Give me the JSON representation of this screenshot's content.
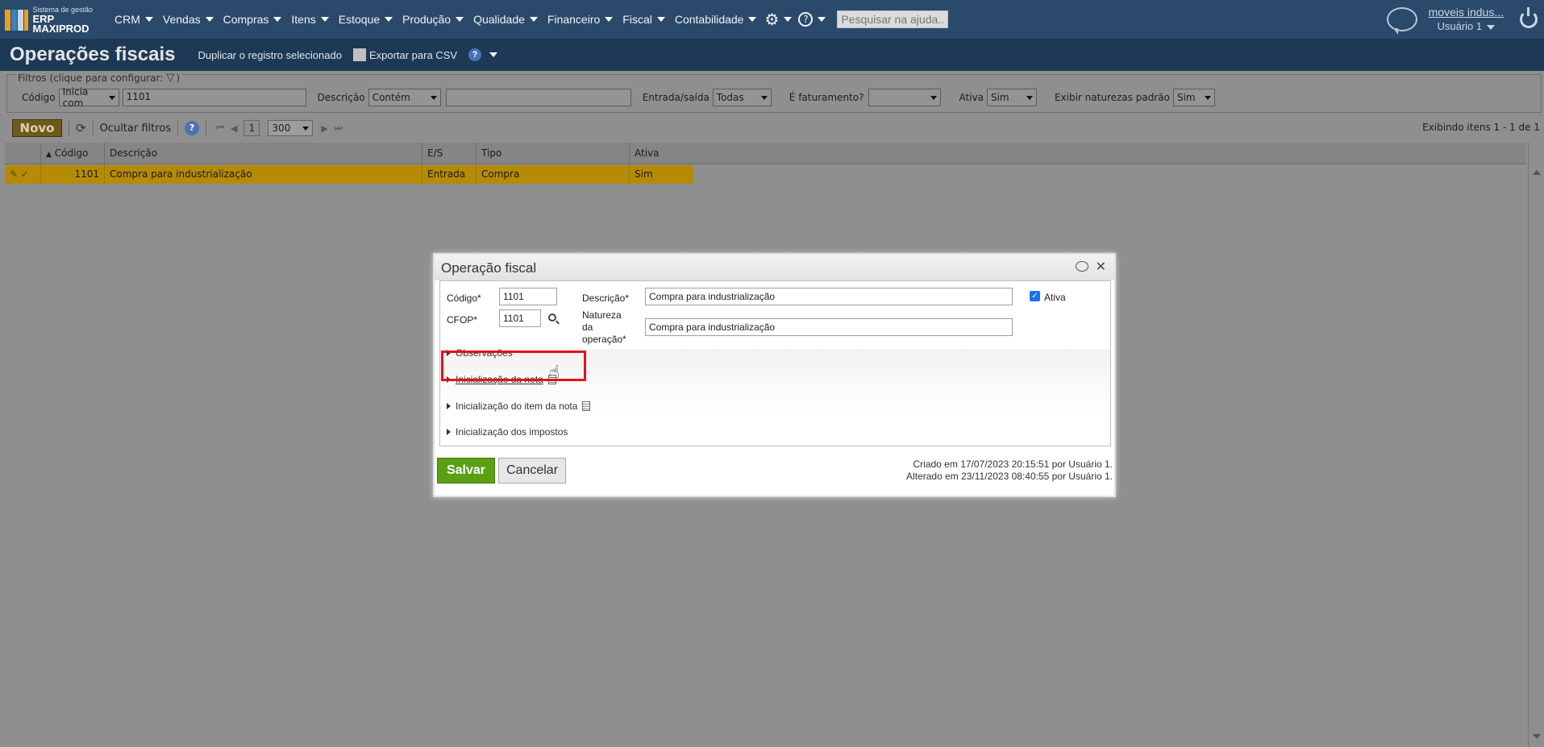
{
  "nav": {
    "logo_small": "Sistema de gestão",
    "logo_big": "ERP MAXIPROD",
    "menu": [
      {
        "label": "CRM"
      },
      {
        "label": "Vendas"
      },
      {
        "label": "Compras"
      },
      {
        "label": "Itens"
      },
      {
        "label": "Estoque"
      },
      {
        "label": "Produção"
      },
      {
        "label": "Qualidade"
      },
      {
        "label": "Financeiro"
      },
      {
        "label": "Fiscal"
      },
      {
        "label": "Contabilidade"
      }
    ],
    "help_placeholder": "Pesquisar na ajuda...",
    "company": "moveis indus...",
    "user": "Usuário 1"
  },
  "titlebar": {
    "title": "Operações fiscais",
    "duplicate": "Duplicar o registro selecionado",
    "export": "Exportar para CSV",
    "help": "?"
  },
  "filters": {
    "legend": "Filtros (clique para configurar:",
    "codigo_label": "Código",
    "codigo_op": "Inicia com",
    "codigo_value": "1101",
    "descricao_label": "Descrição",
    "descricao_op": "Contém",
    "descricao_value": "",
    "es_label": "Entrada/saída",
    "es_value": "Todas",
    "fat_label": "É faturamento?",
    "fat_value": "",
    "ativa_label": "Ativa",
    "ativa_value": "Sim",
    "padrao_label": "Exibir naturezas padrão",
    "padrao_value": "Sim"
  },
  "toolbar": {
    "novo": "Novo",
    "hide_filters": "Ocultar filtros",
    "help": "?",
    "page": "1",
    "page_size": "300",
    "showing": "Exibindo itens 1 - 1 de 1"
  },
  "grid": {
    "columns": [
      "Código",
      "Descrição",
      "E/S",
      "Tipo",
      "Ativa"
    ],
    "rows": [
      {
        "codigo": "1101",
        "descricao": "Compra para industrialização",
        "es": "Entrada",
        "tipo": "Compra",
        "ativa": "Sim"
      }
    ]
  },
  "dialog": {
    "title": "Operação fiscal",
    "codigo_label": "Código*",
    "codigo_value": "1101",
    "cfop_label": "CFOP*",
    "cfop_value": "1101",
    "descricao_label": "Descrição*",
    "descricao_value": "Compra para industrialização",
    "natureza_label_1": "Natureza",
    "natureza_label_2": "da",
    "natureza_label_3": "operação*",
    "natureza_value": "Compra para industrialização",
    "ativa_label": "Ativa",
    "ativa_checked": true,
    "sections": [
      {
        "label": "Observações"
      },
      {
        "label": "Inicialização da nota"
      },
      {
        "label": "Inicialização do item da nota"
      },
      {
        "label": "Inicialização dos impostos"
      }
    ],
    "save": "Salvar",
    "cancel": "Cancelar",
    "created": "Criado em 17/07/2023 20:15:51 por Usuário 1.",
    "modified": "Alterado em 23/11/2023 08:40:55 por Usuário 1."
  },
  "colors": {
    "nav_bg": "#2b4a6b",
    "title_bg": "#1e3955",
    "selected_row": "#b58a06",
    "save_green": "#5aa012",
    "highlight_red": "#e8101b"
  },
  "icons": [
    "settings-icon",
    "help-icon",
    "chat-icon",
    "power-icon",
    "filter-icon",
    "refresh-icon",
    "search-icon",
    "close-icon",
    "document-icon",
    "hand-pointer-icon",
    "sort-asc-icon"
  ]
}
